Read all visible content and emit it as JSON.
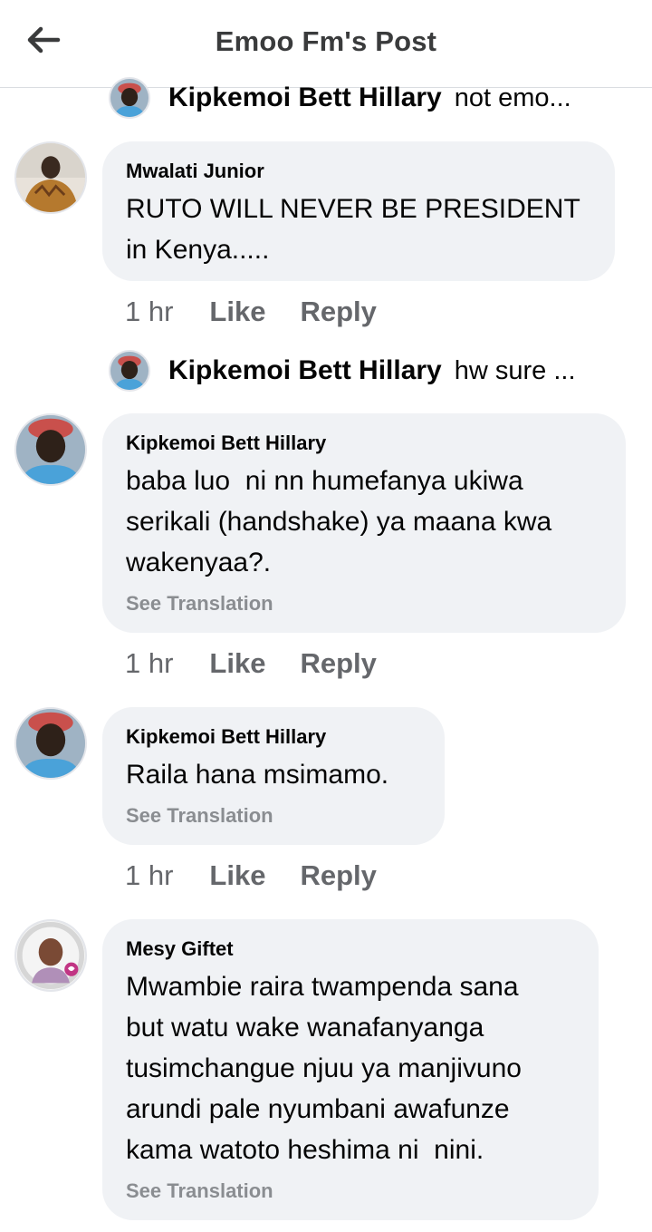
{
  "header": {
    "title": "Emoo Fm's Post"
  },
  "reply_previews": [
    {
      "name": "Kipkemoi Bett Hillary",
      "text": "not emo..."
    },
    {
      "name": "Kipkemoi Bett Hillary",
      "text": "hw sure ..."
    }
  ],
  "comments": [
    {
      "author": "Mwalati Junior",
      "text": "RUTO WILL NEVER BE PRESIDENT\nin Kenya.....",
      "time": "1 hr",
      "like": "Like",
      "reply": "Reply"
    },
    {
      "author": "Kipkemoi Bett Hillary",
      "text": "baba luo  ni nn humefanya ukiwa\nserikali (handshake) ya maana kwa\nwakenyaa?.",
      "see_translation": "See Translation",
      "time": "1 hr",
      "like": "Like",
      "reply": "Reply"
    },
    {
      "author": "Kipkemoi Bett Hillary",
      "text": "Raila hana msimamo.",
      "see_translation": "See Translation",
      "time": "1 hr",
      "like": "Like",
      "reply": "Reply"
    },
    {
      "author": "Mesy Giftet",
      "text": "Mwambie raira twampenda sana\nbut watu wake wanafanyanga\ntusimchangue njuu ya manjivuno\narundi pale nyumbani awafunze\nkama watoto heshima ni  nini.",
      "see_translation": "See Translation"
    }
  ],
  "colors": {
    "bubble": "#f0f2f5",
    "secondary_text": "#65676b",
    "translation_text": "#8a8d91"
  }
}
